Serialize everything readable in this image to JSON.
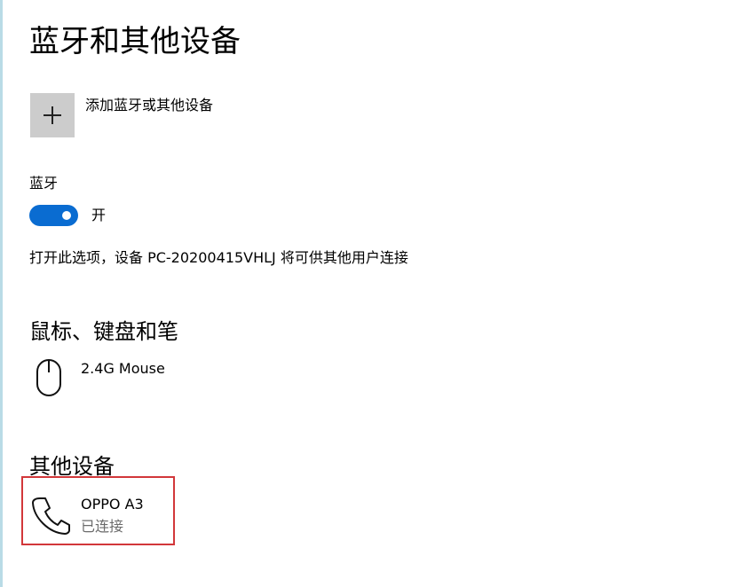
{
  "page": {
    "title": "蓝牙和其他设备"
  },
  "add_device": {
    "label": "添加蓝牙或其他设备",
    "icon": "plus-icon"
  },
  "bluetooth": {
    "label": "蓝牙",
    "toggle_on": true,
    "toggle_state_label": "开",
    "description": "打开此选项，设备 PC-20200415VHLJ 将可供其他用户连接",
    "toggle_color": "#0a6cd1"
  },
  "mouse_section": {
    "heading": "鼠标、键盘和笔",
    "devices": [
      {
        "name": "2.4G Mouse",
        "icon": "mouse-icon"
      }
    ]
  },
  "other_section": {
    "heading": "其他设备",
    "devices": [
      {
        "name": "OPPO A3",
        "status": "已连接",
        "icon": "phone-icon"
      }
    ],
    "highlight_color": "#d2373a"
  }
}
